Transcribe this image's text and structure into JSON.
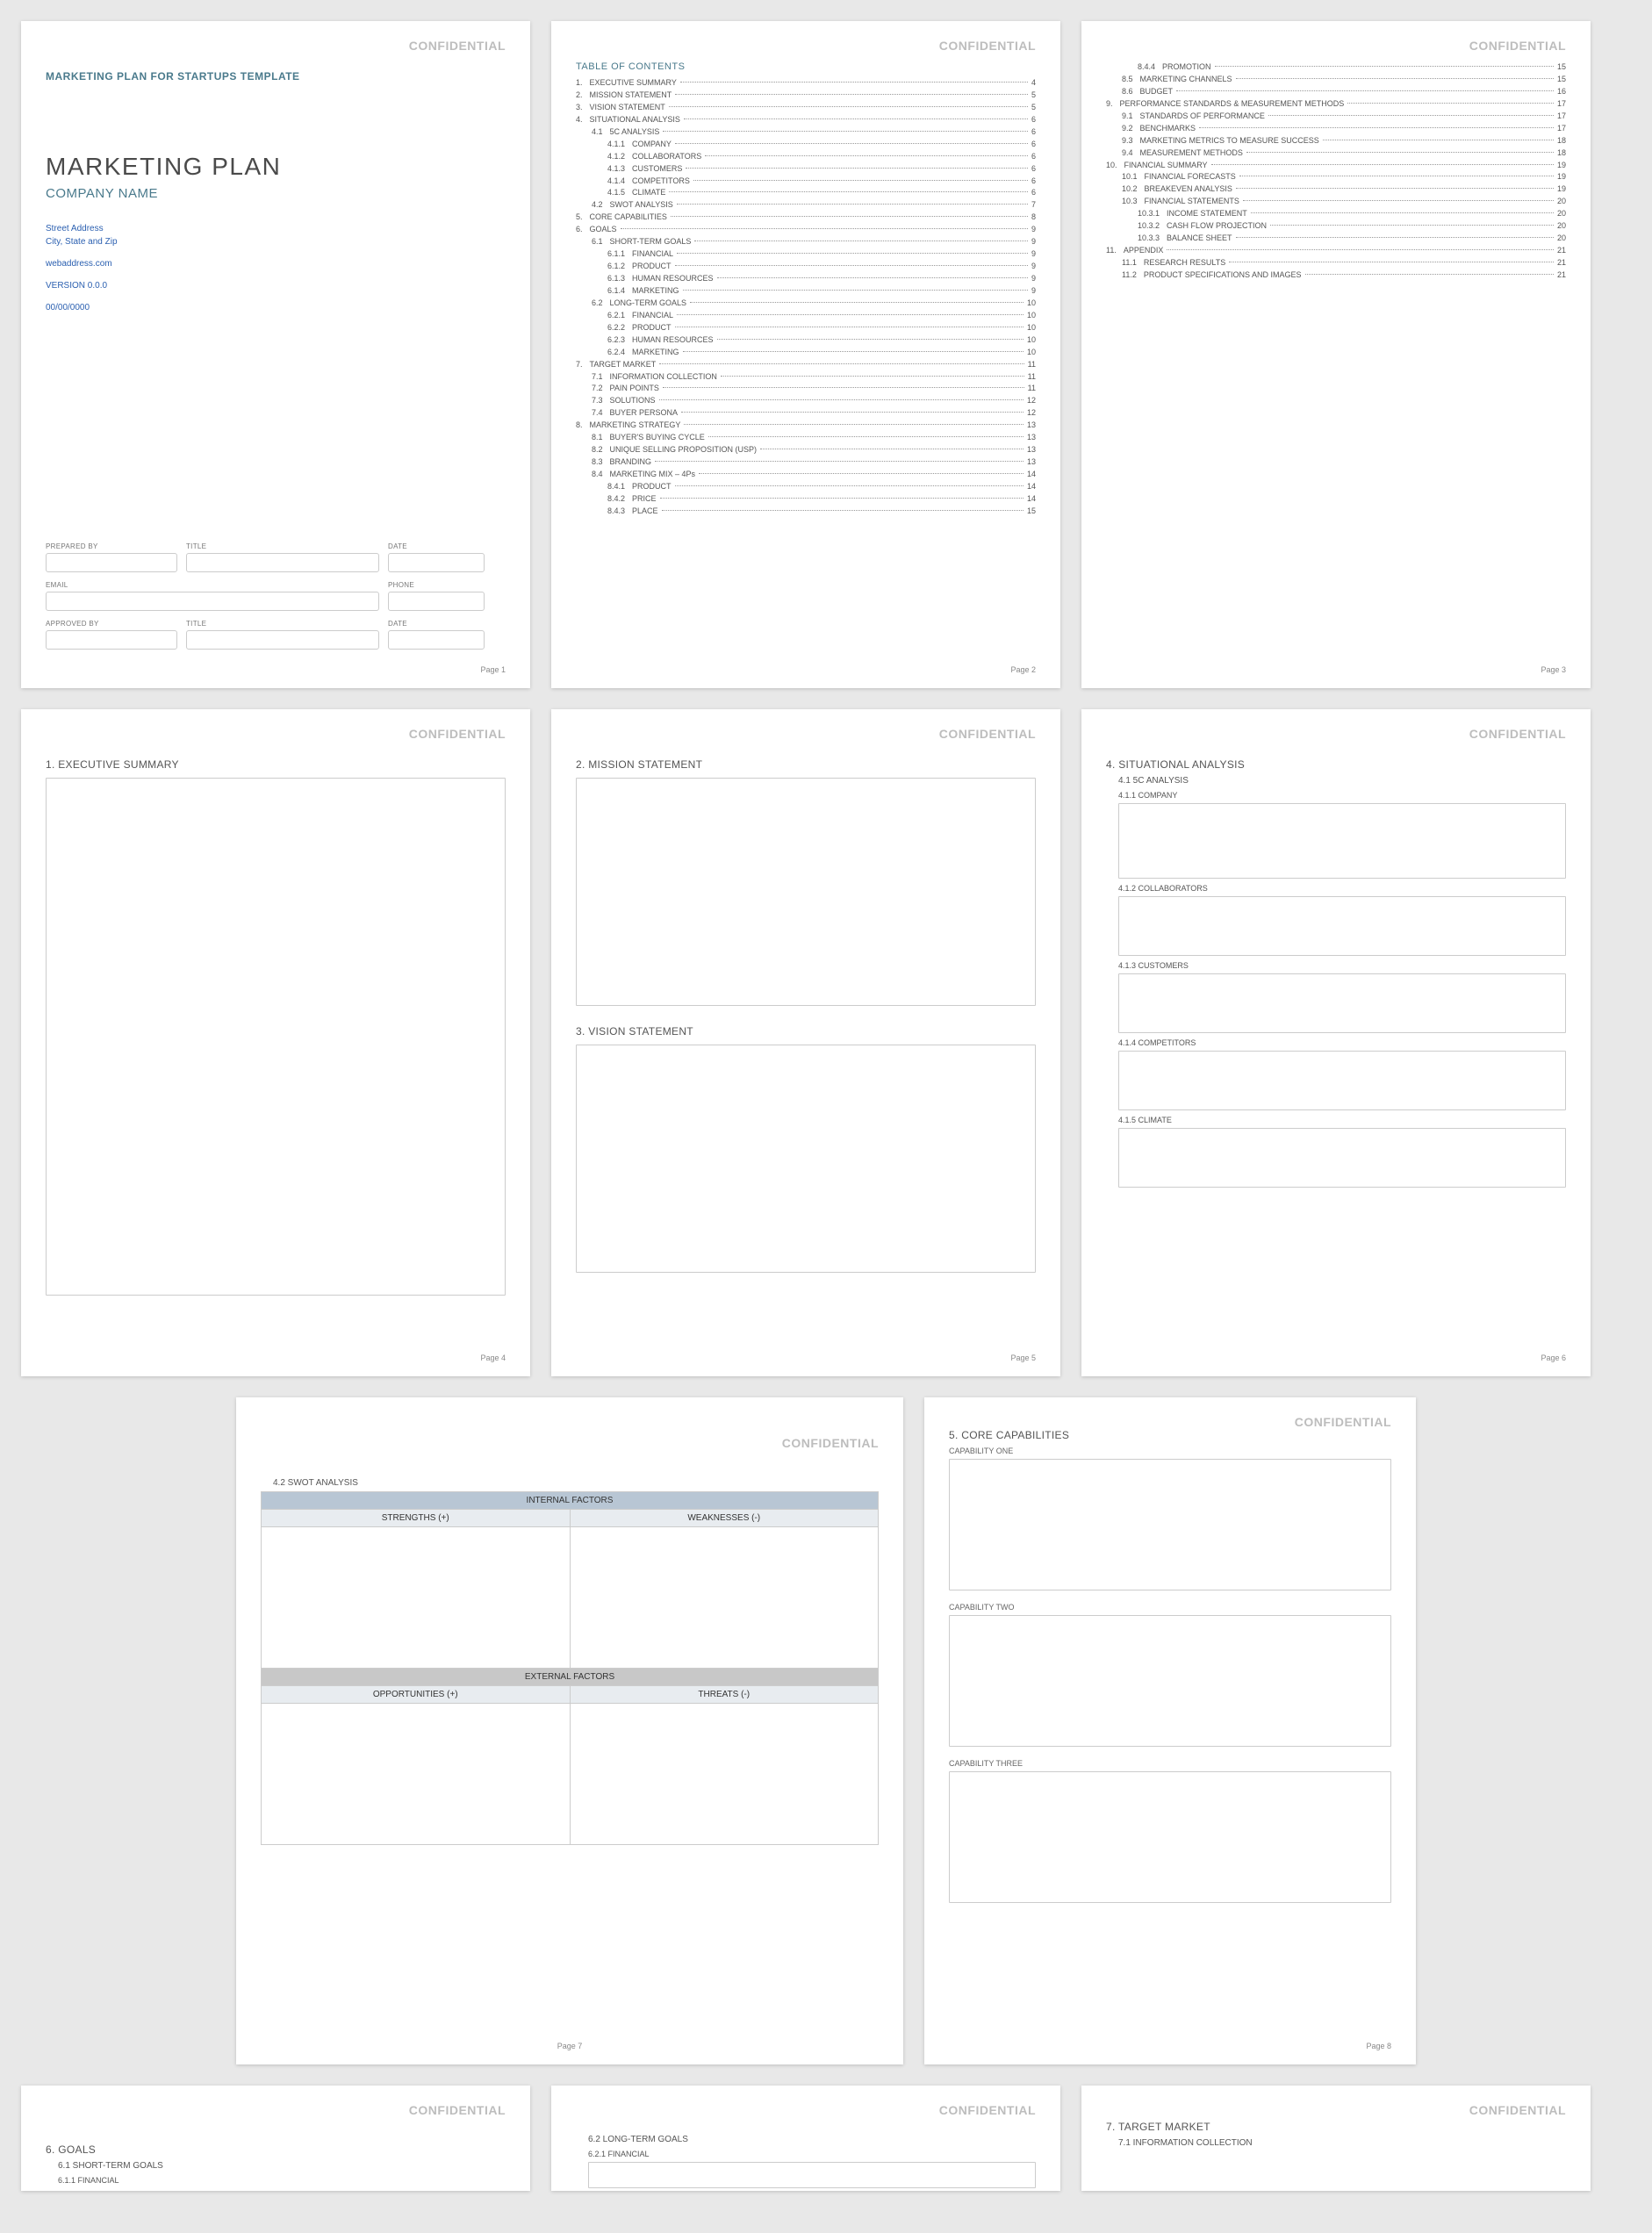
{
  "confidential": "CONFIDENTIAL",
  "page_prefix": "Page ",
  "template_name": "MARKETING PLAN FOR STARTUPS TEMPLATE",
  "doc_title": "MARKETING PLAN",
  "company_name": "COMPANY NAME",
  "address_line1": "Street Address",
  "address_line2": "City, State and Zip",
  "website": "webaddress.com",
  "version": "VERSION 0.0.0",
  "date": "00/00/0000",
  "form": {
    "prepared_by": "PREPARED BY",
    "title": "TITLE",
    "date": "DATE",
    "email": "EMAIL",
    "phone": "PHONE",
    "approved_by": "APPROVED BY"
  },
  "toc_title": "TABLE OF CONTENTS",
  "toc_p2": [
    {
      "n": "1.",
      "l": "EXECUTIVE SUMMARY",
      "p": "4",
      "d": 0
    },
    {
      "n": "2.",
      "l": "MISSION STATEMENT",
      "p": "5",
      "d": 0
    },
    {
      "n": "3.",
      "l": "VISION STATEMENT",
      "p": "5",
      "d": 0
    },
    {
      "n": "4.",
      "l": "SITUATIONAL ANALYSIS",
      "p": "6",
      "d": 0
    },
    {
      "n": "4.1",
      "l": "5C ANALYSIS",
      "p": "6",
      "d": 1
    },
    {
      "n": "4.1.1",
      "l": "COMPANY",
      "p": "6",
      "d": 2
    },
    {
      "n": "4.1.2",
      "l": "COLLABORATORS",
      "p": "6",
      "d": 2
    },
    {
      "n": "4.1.3",
      "l": "CUSTOMERS",
      "p": "6",
      "d": 2
    },
    {
      "n": "4.1.4",
      "l": "COMPETITORS",
      "p": "6",
      "d": 2
    },
    {
      "n": "4.1.5",
      "l": "CLIMATE",
      "p": "6",
      "d": 2
    },
    {
      "n": "4.2",
      "l": "SWOT ANALYSIS",
      "p": "7",
      "d": 1
    },
    {
      "n": "5.",
      "l": "CORE CAPABILITIES",
      "p": "8",
      "d": 0
    },
    {
      "n": "6.",
      "l": "GOALS",
      "p": "9",
      "d": 0
    },
    {
      "n": "6.1",
      "l": "SHORT-TERM GOALS",
      "p": "9",
      "d": 1
    },
    {
      "n": "6.1.1",
      "l": "FINANCIAL",
      "p": "9",
      "d": 2
    },
    {
      "n": "6.1.2",
      "l": "PRODUCT",
      "p": "9",
      "d": 2
    },
    {
      "n": "6.1.3",
      "l": "HUMAN RESOURCES",
      "p": "9",
      "d": 2
    },
    {
      "n": "6.1.4",
      "l": "MARKETING",
      "p": "9",
      "d": 2
    },
    {
      "n": "6.2",
      "l": "LONG-TERM GOALS",
      "p": "10",
      "d": 1
    },
    {
      "n": "6.2.1",
      "l": "FINANCIAL",
      "p": "10",
      "d": 2
    },
    {
      "n": "6.2.2",
      "l": "PRODUCT",
      "p": "10",
      "d": 2
    },
    {
      "n": "6.2.3",
      "l": "HUMAN RESOURCES",
      "p": "10",
      "d": 2
    },
    {
      "n": "6.2.4",
      "l": "MARKETING",
      "p": "10",
      "d": 2
    },
    {
      "n": "7.",
      "l": "TARGET MARKET",
      "p": "11",
      "d": 0
    },
    {
      "n": "7.1",
      "l": "INFORMATION COLLECTION",
      "p": "11",
      "d": 1
    },
    {
      "n": "7.2",
      "l": "PAIN POINTS",
      "p": "11",
      "d": 1
    },
    {
      "n": "7.3",
      "l": "SOLUTIONS",
      "p": "12",
      "d": 1
    },
    {
      "n": "7.4",
      "l": "BUYER PERSONA",
      "p": "12",
      "d": 1
    },
    {
      "n": "8.",
      "l": "MARKETING STRATEGY",
      "p": "13",
      "d": 0
    },
    {
      "n": "8.1",
      "l": "BUYER'S BUYING CYCLE",
      "p": "13",
      "d": 1
    },
    {
      "n": "8.2",
      "l": "UNIQUE SELLING PROPOSITION (USP)",
      "p": "13",
      "d": 1
    },
    {
      "n": "8.3",
      "l": "BRANDING",
      "p": "13",
      "d": 1
    },
    {
      "n": "8.4",
      "l": "MARKETING MIX – 4Ps",
      "p": "14",
      "d": 1
    },
    {
      "n": "8.4.1",
      "l": "PRODUCT",
      "p": "14",
      "d": 2
    },
    {
      "n": "8.4.2",
      "l": "PRICE",
      "p": "14",
      "d": 2
    },
    {
      "n": "8.4.3",
      "l": "PLACE",
      "p": "15",
      "d": 2
    }
  ],
  "toc_p3": [
    {
      "n": "8.4.4",
      "l": "PROMOTION",
      "p": "15",
      "d": 2
    },
    {
      "n": "8.5",
      "l": "MARKETING CHANNELS",
      "p": "15",
      "d": 1
    },
    {
      "n": "8.6",
      "l": "BUDGET",
      "p": "16",
      "d": 1
    },
    {
      "n": "9.",
      "l": "PERFORMANCE STANDARDS & MEASUREMENT METHODS",
      "p": "17",
      "d": 0
    },
    {
      "n": "9.1",
      "l": "STANDARDS OF PERFORMANCE",
      "p": "17",
      "d": 1
    },
    {
      "n": "9.2",
      "l": "BENCHMARKS",
      "p": "17",
      "d": 1
    },
    {
      "n": "9.3",
      "l": "MARKETING METRICS TO MEASURE SUCCESS",
      "p": "18",
      "d": 1
    },
    {
      "n": "9.4",
      "l": "MEASUREMENT METHODS",
      "p": "18",
      "d": 1
    },
    {
      "n": "10.",
      "l": "FINANCIAL SUMMARY",
      "p": "19",
      "d": 0
    },
    {
      "n": "10.1",
      "l": "FINANCIAL FORECASTS",
      "p": "19",
      "d": 1
    },
    {
      "n": "10.2",
      "l": "BREAKEVEN ANALYSIS",
      "p": "19",
      "d": 1
    },
    {
      "n": "10.3",
      "l": "FINANCIAL STATEMENTS",
      "p": "20",
      "d": 1
    },
    {
      "n": "10.3.1",
      "l": "INCOME STATEMENT",
      "p": "20",
      "d": 2
    },
    {
      "n": "10.3.2",
      "l": "CASH FLOW PROJECTION",
      "p": "20",
      "d": 2
    },
    {
      "n": "10.3.3",
      "l": "BALANCE SHEET",
      "p": "20",
      "d": 2
    },
    {
      "n": "11.",
      "l": "APPENDIX",
      "p": "21",
      "d": 0
    },
    {
      "n": "11.1",
      "l": "RESEARCH RESULTS",
      "p": "21",
      "d": 1
    },
    {
      "n": "11.2",
      "l": "PRODUCT SPECIFICATIONS AND IMAGES",
      "p": "21",
      "d": 1
    }
  ],
  "sec": {
    "h1": "1.  EXECUTIVE SUMMARY",
    "h2": "2.  MISSION STATEMENT",
    "h3": "3.  VISION STATEMENT",
    "h4": "4.  SITUATIONAL ANALYSIS",
    "h4_1": "4.1   5C ANALYSIS",
    "h4_1_1": "4.1.1  COMPANY",
    "h4_1_2": "4.1.2  COLLABORATORS",
    "h4_1_3": "4.1.3  CUSTOMERS",
    "h4_1_4": "4.1.4  COMPETITORS",
    "h4_1_5": "4.1.5  CLIMATE",
    "h4_2": "4.2   SWOT ANALYSIS",
    "h5": "5.  CORE CAPABILITIES",
    "cap1": "CAPABILITY ONE",
    "cap2": "CAPABILITY TWO",
    "cap3": "CAPABILITY THREE",
    "h6": "6.  GOALS",
    "h6_1": "6.1   SHORT-TERM GOALS",
    "h6_1_1": "6.1.1  FINANCIAL",
    "h6_2": "6.2   LONG-TERM GOALS",
    "h6_2_1": "6.2.1  FINANCIAL",
    "h7": "7.  TARGET MARKET",
    "h7_1": "7.1   INFORMATION COLLECTION"
  },
  "swot": {
    "internal": "INTERNAL FACTORS",
    "external": "EXTERNAL FACTORS",
    "strengths": "STRENGTHS (+)",
    "weaknesses": "WEAKNESSES (-)",
    "opportunities": "OPPORTUNITIES (+)",
    "threats": "THREATS (-)"
  },
  "page_numbers": {
    "p1": "1",
    "p2": "2",
    "p3": "3",
    "p4": "4",
    "p5": "5",
    "p6": "6",
    "p7": "7",
    "p8": "8"
  }
}
